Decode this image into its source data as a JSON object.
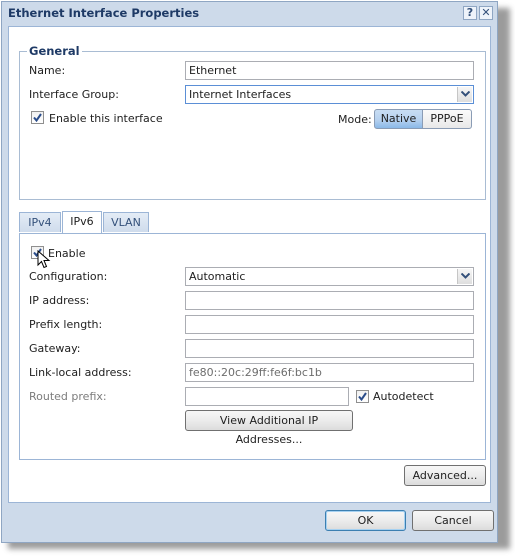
{
  "window": {
    "title": "Ethernet Interface Properties",
    "help_label": "?",
    "close_label": "✕"
  },
  "general": {
    "legend": "General",
    "name_label": "Name:",
    "name_value": "Ethernet",
    "group_label": "Interface Group:",
    "group_value": "Internet Interfaces",
    "enable_label": "Enable this interface",
    "enable_checked": true,
    "mode_label": "Mode:",
    "mode_options": [
      "Native",
      "PPPoE"
    ],
    "mode_selected": "Native"
  },
  "tabs": [
    {
      "label": "IPv4",
      "active": false
    },
    {
      "label": "IPv6",
      "active": true
    },
    {
      "label": "VLAN",
      "active": false
    }
  ],
  "ipv6": {
    "enable_label": "Enable",
    "enable_checked": true,
    "config_label": "Configuration:",
    "config_value": "Automatic",
    "ip_label": "IP address:",
    "ip_value": "",
    "prefix_label": "Prefix length:",
    "prefix_value": "",
    "gateway_label": "Gateway:",
    "gateway_value": "",
    "linklocal_label": "Link-local address:",
    "linklocal_value": "fe80::20c:29ff:fe6f:bc1b",
    "routed_label": "Routed prefix:",
    "routed_value": "",
    "autodetect_label": "Autodetect",
    "autodetect_checked": true,
    "view_additional_label": "View Additional IP Addresses..."
  },
  "buttons": {
    "advanced": "Advanced...",
    "ok": "OK",
    "cancel": "Cancel"
  },
  "colors": {
    "frame": "#cddaea",
    "accent": "#1e3a66",
    "mode_selected": "#b6d1ef"
  }
}
